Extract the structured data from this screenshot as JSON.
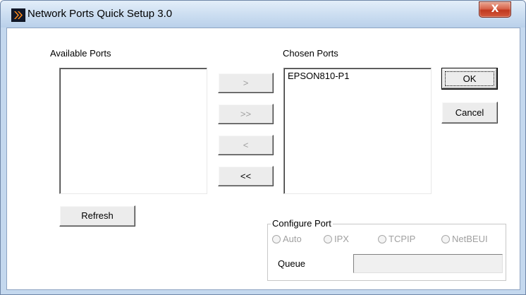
{
  "window": {
    "title": "Network Ports Quick Setup 3.0",
    "close_label": "X"
  },
  "available": {
    "label": "Available Ports",
    "items": []
  },
  "chosen": {
    "label": "Chosen Ports",
    "items": [
      "EPSON810-P1"
    ]
  },
  "move_buttons": {
    "add": ">",
    "add_all": ">>",
    "remove": "<",
    "remove_all": "<<"
  },
  "actions": {
    "ok": "OK",
    "cancel": "Cancel",
    "refresh": "Refresh"
  },
  "configure": {
    "legend": "Configure Port",
    "radios": [
      "Auto",
      "IPX",
      "TCPIP",
      "NetBEUI"
    ],
    "queue_label": "Queue",
    "queue_value": ""
  },
  "icons": {
    "app": "double-chevron-right-icon"
  },
  "colors": {
    "titlebar": "#c4d8ee",
    "close_button": "#c0391f",
    "disabled_text": "#a0a0a0"
  }
}
